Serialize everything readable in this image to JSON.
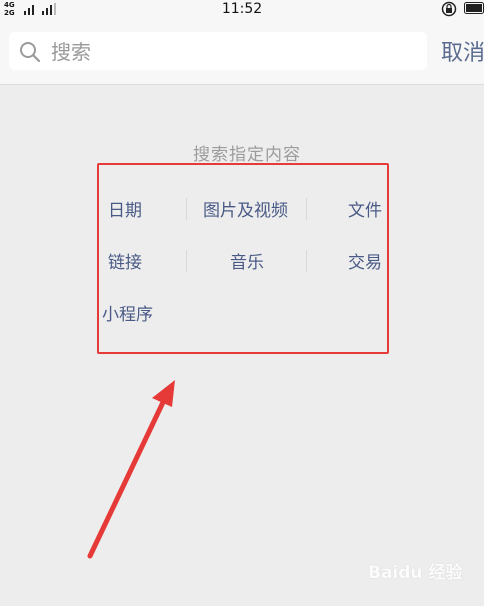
{
  "status_bar": {
    "network_top": "4G",
    "network_bottom": "2G",
    "time": "11:52"
  },
  "search": {
    "placeholder": "搜索",
    "cancel_label": "取消"
  },
  "hint_title": "搜索指定内容",
  "categories": [
    {
      "label": "日期"
    },
    {
      "label": "图片及视频"
    },
    {
      "label": "文件"
    },
    {
      "label": "链接"
    },
    {
      "label": "音乐"
    },
    {
      "label": "交易"
    },
    {
      "label": "小程序"
    }
  ],
  "watermark": "Baidu 经验",
  "colors": {
    "accent": "#5b6b90",
    "category_text": "#4a5a86",
    "highlight": "#e53a37",
    "background": "#ededed"
  },
  "icons": {
    "search": "search-icon",
    "lock": "rotation-lock-icon",
    "battery": "battery-icon"
  }
}
